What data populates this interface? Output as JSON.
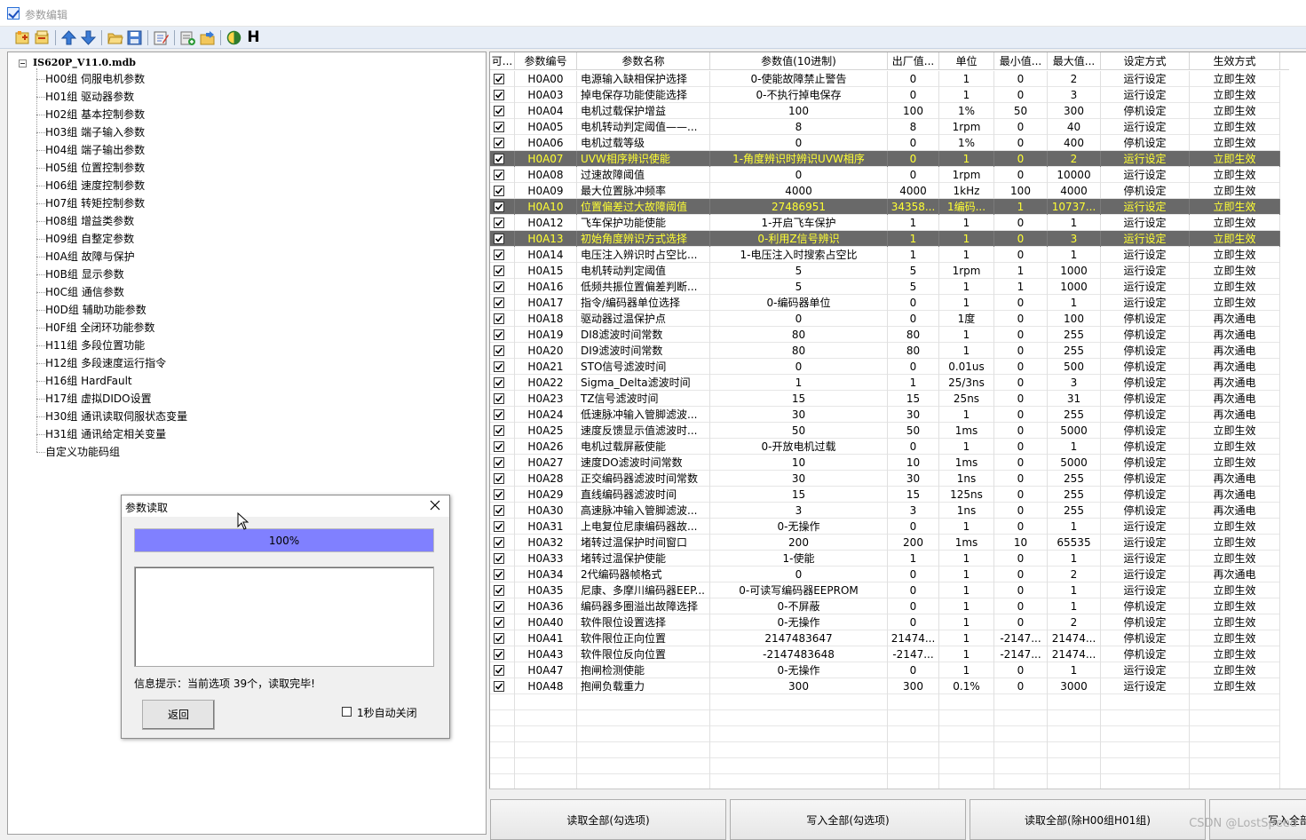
{
  "window": {
    "title": "参数编辑"
  },
  "toolbar": {
    "items": [
      "new-icon",
      "copy-icon",
      "move-up-icon",
      "move-down-icon",
      "open-folder-icon",
      "save-icon",
      "edit-icon",
      "add-icon",
      "import-icon",
      "contrast-icon",
      "h-icon"
    ],
    "h_label": "H"
  },
  "tree": {
    "root": "IS620P_V11.0.mdb",
    "items": [
      "H00组 伺服电机参数",
      "H01组 驱动器参数",
      "H02组 基本控制参数",
      "H03组 端子输入参数",
      "H04组 端子输出参数",
      "H05组 位置控制参数",
      "H06组 速度控制参数",
      "H07组 转矩控制参数",
      "H08组 增益类参数",
      "H09组 自整定参数",
      "H0A组 故障与保护",
      "H0B组 显示参数",
      "H0C组 通信参数",
      "H0D组 辅助功能参数",
      "H0F组 全闭环功能参数",
      "H11组 多段位置功能",
      "H12组 多段速度运行指令",
      "H16组 HardFault",
      "H17组 虚拟DIDO设置",
      "H30组 通讯读取伺服状态变量",
      "H31组 通讯给定相关变量",
      "自定义功能码组"
    ]
  },
  "grid": {
    "headers": [
      "可...",
      "参数编号",
      "参数名称",
      "参数值(10进制)",
      "出厂值...",
      "单位",
      "最小值...",
      "最大值...",
      "设定方式",
      "生效方式"
    ],
    "rows": [
      {
        "checked": true,
        "sel": false,
        "cells": [
          "H0A00",
          "电源输入缺相保护选择",
          "0-使能故障禁止警告",
          "0",
          "1",
          "0",
          "2",
          "运行设定",
          "立即生效"
        ]
      },
      {
        "checked": true,
        "sel": false,
        "cells": [
          "H0A03",
          "掉电保存功能使能选择",
          "0-不执行掉电保存",
          "0",
          "1",
          "0",
          "3",
          "运行设定",
          "立即生效"
        ]
      },
      {
        "checked": true,
        "sel": false,
        "cells": [
          "H0A04",
          "电机过载保护增益",
          "100",
          "100",
          "1%",
          "50",
          "300",
          "停机设定",
          "立即生效"
        ]
      },
      {
        "checked": true,
        "sel": false,
        "cells": [
          "H0A05",
          "电机转动判定阈值——...",
          "8",
          "8",
          "1rpm",
          "0",
          "40",
          "运行设定",
          "立即生效"
        ]
      },
      {
        "checked": true,
        "sel": false,
        "cells": [
          "H0A06",
          "电机过载等级",
          "0",
          "0",
          "1%",
          "0",
          "400",
          "停机设定",
          "立即生效"
        ]
      },
      {
        "checked": true,
        "sel": true,
        "cells": [
          "H0A07",
          "UVW相序辨识使能",
          "1-角度辨识时辨识UVW相序",
          "0",
          "1",
          "0",
          "2",
          "运行设定",
          "立即生效"
        ]
      },
      {
        "checked": true,
        "sel": false,
        "cells": [
          "H0A08",
          "过速故障阈值",
          "0",
          "0",
          "1rpm",
          "0",
          "10000",
          "运行设定",
          "立即生效"
        ]
      },
      {
        "checked": true,
        "sel": false,
        "cells": [
          "H0A09",
          "最大位置脉冲频率",
          "4000",
          "4000",
          "1kHz",
          "100",
          "4000",
          "停机设定",
          "立即生效"
        ]
      },
      {
        "checked": true,
        "sel": true,
        "cells": [
          "H0A10",
          "位置偏差过大故障阈值",
          "27486951",
          "34358...",
          "1编码...",
          "1",
          "10737...",
          "运行设定",
          "立即生效"
        ]
      },
      {
        "checked": true,
        "sel": false,
        "cells": [
          "H0A12",
          "飞车保护功能使能",
          "1-开启飞车保护",
          "1",
          "1",
          "0",
          "1",
          "运行设定",
          "立即生效"
        ]
      },
      {
        "checked": true,
        "sel": true,
        "cells": [
          "H0A13",
          "初始角度辨识方式选择",
          "0-利用Z信号辨识",
          "1",
          "1",
          "0",
          "3",
          "运行设定",
          "立即生效"
        ]
      },
      {
        "checked": true,
        "sel": false,
        "cells": [
          "H0A14",
          "电压注入辨识时占空比...",
          "1-电压注入时搜索占空比",
          "1",
          "1",
          "0",
          "1",
          "运行设定",
          "立即生效"
        ]
      },
      {
        "checked": true,
        "sel": false,
        "cells": [
          "H0A15",
          "电机转动判定阈值",
          "5",
          "5",
          "1rpm",
          "1",
          "1000",
          "运行设定",
          "立即生效"
        ]
      },
      {
        "checked": true,
        "sel": false,
        "cells": [
          "H0A16",
          "低频共振位置偏差判断...",
          "5",
          "5",
          "1",
          "1",
          "1000",
          "运行设定",
          "立即生效"
        ]
      },
      {
        "checked": true,
        "sel": false,
        "cells": [
          "H0A17",
          "指令/编码器单位选择",
          "0-编码器单位",
          "0",
          "1",
          "0",
          "1",
          "运行设定",
          "立即生效"
        ]
      },
      {
        "checked": true,
        "sel": false,
        "cells": [
          "H0A18",
          "驱动器过温保护点",
          "0",
          "0",
          "1度",
          "0",
          "100",
          "停机设定",
          "再次通电"
        ]
      },
      {
        "checked": true,
        "sel": false,
        "cells": [
          "H0A19",
          "DI8滤波时间常数",
          "80",
          "80",
          "1",
          "0",
          "255",
          "停机设定",
          "再次通电"
        ]
      },
      {
        "checked": true,
        "sel": false,
        "cells": [
          "H0A20",
          "DI9滤波时间常数",
          "80",
          "80",
          "1",
          "0",
          "255",
          "停机设定",
          "再次通电"
        ]
      },
      {
        "checked": true,
        "sel": false,
        "cells": [
          "H0A21",
          "STO信号滤波时间",
          "0",
          "0",
          "0.01us",
          "0",
          "500",
          "停机设定",
          "再次通电"
        ]
      },
      {
        "checked": true,
        "sel": false,
        "cells": [
          "H0A22",
          "Sigma_Delta滤波时间",
          "1",
          "1",
          "25/3ns",
          "0",
          "3",
          "停机设定",
          "再次通电"
        ]
      },
      {
        "checked": true,
        "sel": false,
        "cells": [
          "H0A23",
          "TZ信号滤波时间",
          "15",
          "15",
          "25ns",
          "0",
          "31",
          "停机设定",
          "再次通电"
        ]
      },
      {
        "checked": true,
        "sel": false,
        "cells": [
          "H0A24",
          "低速脉冲输入管脚滤波...",
          "30",
          "30",
          "1",
          "0",
          "255",
          "停机设定",
          "再次通电"
        ]
      },
      {
        "checked": true,
        "sel": false,
        "cells": [
          "H0A25",
          "速度反馈显示值滤波时...",
          "50",
          "50",
          "1ms",
          "0",
          "5000",
          "停机设定",
          "立即生效"
        ]
      },
      {
        "checked": true,
        "sel": false,
        "cells": [
          "H0A26",
          "电机过载屏蔽使能",
          "0-开放电机过载",
          "0",
          "1",
          "0",
          "1",
          "停机设定",
          "立即生效"
        ]
      },
      {
        "checked": true,
        "sel": false,
        "cells": [
          "H0A27",
          "速度DO滤波时间常数",
          "10",
          "10",
          "1ms",
          "0",
          "5000",
          "停机设定",
          "立即生效"
        ]
      },
      {
        "checked": true,
        "sel": false,
        "cells": [
          "H0A28",
          "正交编码器滤波时间常数",
          "30",
          "30",
          "1ns",
          "0",
          "255",
          "停机设定",
          "再次通电"
        ]
      },
      {
        "checked": true,
        "sel": false,
        "cells": [
          "H0A29",
          "直线编码器滤波时间",
          "15",
          "15",
          "125ns",
          "0",
          "255",
          "停机设定",
          "再次通电"
        ]
      },
      {
        "checked": true,
        "sel": false,
        "cells": [
          "H0A30",
          "高速脉冲输入管脚滤波...",
          "3",
          "3",
          "1ns",
          "0",
          "255",
          "停机设定",
          "再次通电"
        ]
      },
      {
        "checked": true,
        "sel": false,
        "cells": [
          "H0A31",
          "上电复位尼康编码器故...",
          "0-无操作",
          "0",
          "1",
          "0",
          "1",
          "运行设定",
          "立即生效"
        ]
      },
      {
        "checked": true,
        "sel": false,
        "cells": [
          "H0A32",
          "堵转过温保护时间窗口",
          "200",
          "200",
          "1ms",
          "10",
          "65535",
          "运行设定",
          "立即生效"
        ]
      },
      {
        "checked": true,
        "sel": false,
        "cells": [
          "H0A33",
          "堵转过温保护使能",
          "1-使能",
          "1",
          "1",
          "0",
          "1",
          "运行设定",
          "立即生效"
        ]
      },
      {
        "checked": true,
        "sel": false,
        "cells": [
          "H0A34",
          "2代编码器帧格式",
          "0",
          "0",
          "1",
          "0",
          "2",
          "运行设定",
          "再次通电"
        ]
      },
      {
        "checked": true,
        "sel": false,
        "cells": [
          "H0A35",
          "尼康、多摩川编码器EEP...",
          "0-可读写编码器EEPROM",
          "0",
          "1",
          "0",
          "1",
          "运行设定",
          "立即生效"
        ]
      },
      {
        "checked": true,
        "sel": false,
        "cells": [
          "H0A36",
          "编码器多圈溢出故障选择",
          "0-不屏蔽",
          "0",
          "1",
          "0",
          "1",
          "停机设定",
          "立即生效"
        ]
      },
      {
        "checked": true,
        "sel": false,
        "cells": [
          "H0A40",
          "软件限位设置选择",
          "0-无操作",
          "0",
          "1",
          "0",
          "2",
          "停机设定",
          "立即生效"
        ]
      },
      {
        "checked": true,
        "sel": false,
        "cells": [
          "H0A41",
          "软件限位正向位置",
          "2147483647",
          "21474...",
          "1",
          "-2147...",
          "21474...",
          "停机设定",
          "立即生效"
        ]
      },
      {
        "checked": true,
        "sel": false,
        "cells": [
          "H0A43",
          "软件限位反向位置",
          "-2147483648",
          "-2147...",
          "1",
          "-2147...",
          "21474...",
          "停机设定",
          "立即生效"
        ]
      },
      {
        "checked": true,
        "sel": false,
        "cells": [
          "H0A47",
          "抱闸检测使能",
          "0-无操作",
          "0",
          "1",
          "0",
          "1",
          "运行设定",
          "立即生效"
        ]
      },
      {
        "checked": true,
        "sel": false,
        "cells": [
          "H0A48",
          "抱闸负载重力",
          "300",
          "300",
          "0.1%",
          "0",
          "3000",
          "运行设定",
          "立即生效"
        ]
      }
    ]
  },
  "buttons": [
    "读取全部(勾选项)",
    "写入全部(勾选项)",
    "读取全部(除H00组H01组)",
    "写入全部"
  ],
  "watermark": "CSDN @LostSpeed",
  "dialog": {
    "title": "参数读取",
    "progress_text": "100%",
    "progress": 1.0,
    "info": "信息提示：当前选项 39个，读取完毕!",
    "back_label": "返回",
    "autoclose_label": "1秒自动关闭",
    "autoclose_checked": false
  },
  "colors": {
    "selected_row_bg": "#696969",
    "selected_row_text": "#ffff33",
    "progress_fill": "#8080ff"
  }
}
